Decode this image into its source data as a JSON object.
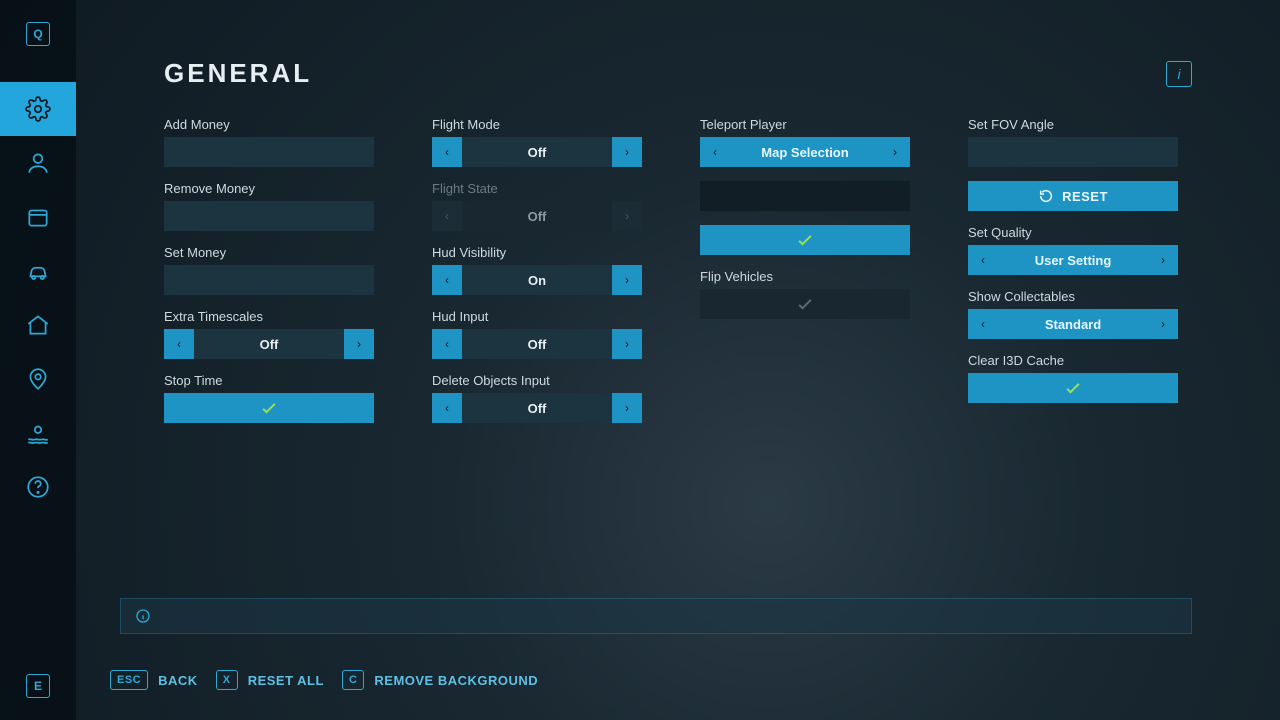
{
  "sidebar": {
    "top_key": "Q",
    "bottom_key": "E",
    "items": [
      {
        "name": "settings",
        "active": true
      },
      {
        "name": "player",
        "active": false
      },
      {
        "name": "inventory",
        "active": false
      },
      {
        "name": "vehicles",
        "active": false
      },
      {
        "name": "buildings",
        "active": false
      },
      {
        "name": "map",
        "active": false
      },
      {
        "name": "environment",
        "active": false
      },
      {
        "name": "help",
        "active": false
      }
    ]
  },
  "header": {
    "title": "GENERAL",
    "info_label": "i"
  },
  "columns": {
    "c1": {
      "add_money_label": "Add Money",
      "remove_money_label": "Remove Money",
      "set_money_label": "Set Money",
      "extra_timescales_label": "Extra Timescales",
      "extra_timescales_value": "Off",
      "stop_time_label": "Stop Time"
    },
    "c2": {
      "flight_mode_label": "Flight Mode",
      "flight_mode_value": "Off",
      "flight_state_label": "Flight State",
      "flight_state_value": "Off",
      "hud_visibility_label": "Hud Visibility",
      "hud_visibility_value": "On",
      "hud_input_label": "Hud Input",
      "hud_input_value": "Off",
      "delete_objects_label": "Delete Objects Input",
      "delete_objects_value": "Off"
    },
    "c3": {
      "teleport_player_label": "Teleport Player",
      "teleport_player_value": "Map Selection",
      "flip_vehicles_label": "Flip Vehicles"
    },
    "c4": {
      "set_fov_label": "Set FOV Angle",
      "reset_label": "RESET",
      "set_quality_label": "Set Quality",
      "set_quality_value": "User Setting",
      "show_collectables_label": "Show Collectables",
      "show_collectables_value": "Standard",
      "clear_cache_label": "Clear I3D Cache"
    }
  },
  "footer": {
    "back_key": "ESC",
    "back_label": "BACK",
    "reset_key": "X",
    "reset_label": "RESET ALL",
    "removebg_key": "C",
    "removebg_label": "REMOVE BACKGROUND"
  }
}
